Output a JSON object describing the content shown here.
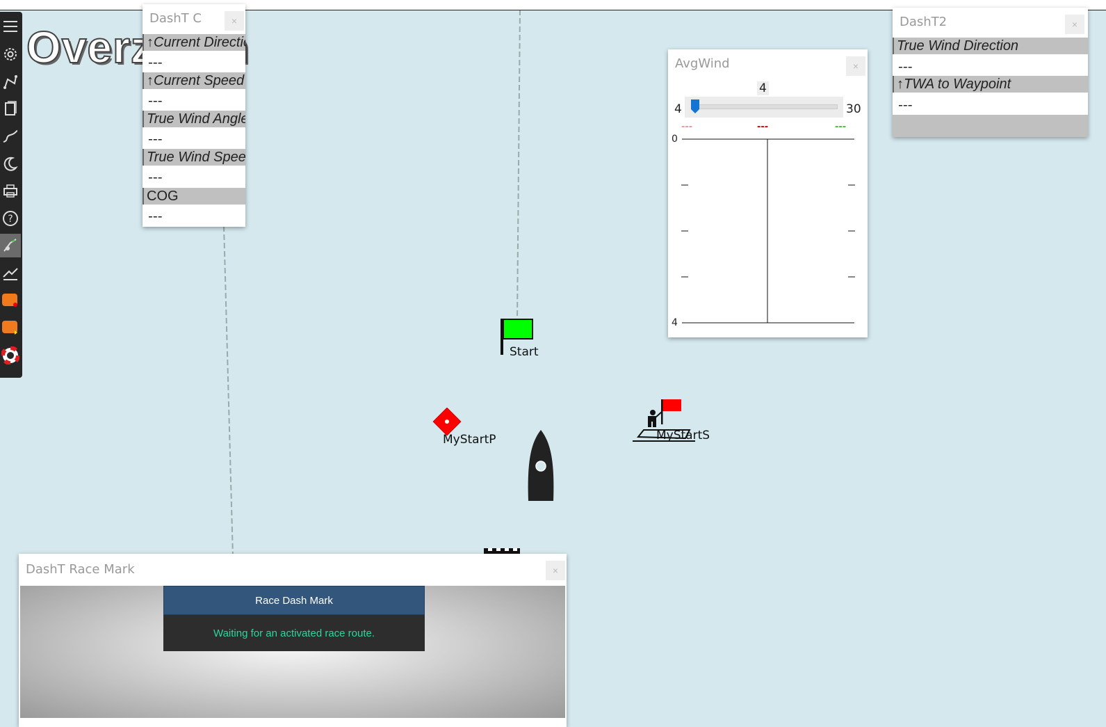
{
  "chart": {
    "overzoom_text": "Overzoom",
    "start_label": "Start",
    "mystartp_label": "MyStartP",
    "mystarts_label": "MyStartS",
    "colors": {
      "sea": "#d4e8ee",
      "start_flag": "#00ff00",
      "mark": "#ff0000"
    }
  },
  "toolbar": {
    "icons": [
      "menu-icon",
      "settings-icon",
      "route-icon",
      "document-icon",
      "track-icon",
      "night-mode-icon",
      "print-icon",
      "help-icon",
      "plugin-icon",
      "chart-plugin-icon",
      "dashboard-icon",
      "dashboard-alt-icon",
      "lifebuoy-icon"
    ]
  },
  "dasht_c": {
    "title": "DashT C",
    "close": "×",
    "rows": [
      {
        "label": "↑Current Direction",
        "value": "---"
      },
      {
        "label": "↑Current Speed",
        "value": "---"
      },
      {
        "label": "True Wind Angle",
        "value": "---"
      },
      {
        "label": "True Wind Speed",
        "value": "---"
      },
      {
        "label": "COG",
        "value": "---"
      }
    ]
  },
  "dasht2": {
    "title": "DashT2",
    "close": "×",
    "rows": [
      {
        "label": "True Wind Direction",
        "value": "---"
      },
      {
        "label": "↑TWA to Waypoint",
        "value": "---"
      }
    ]
  },
  "avgwind": {
    "title": "AvgWind",
    "close": "×",
    "slider_value": "4",
    "slider_min": "4",
    "slider_max": "30",
    "legend": [
      "---",
      "---",
      "---"
    ],
    "legend_colors": [
      "#e89a9a",
      "#e00000",
      "#37c837"
    ],
    "y_top": "0",
    "y_bottom": "4"
  },
  "race_mark": {
    "title": "DashT Race Mark",
    "close": "×",
    "header": "Race Dash Mark",
    "message": "Waiting for an activated race route."
  }
}
